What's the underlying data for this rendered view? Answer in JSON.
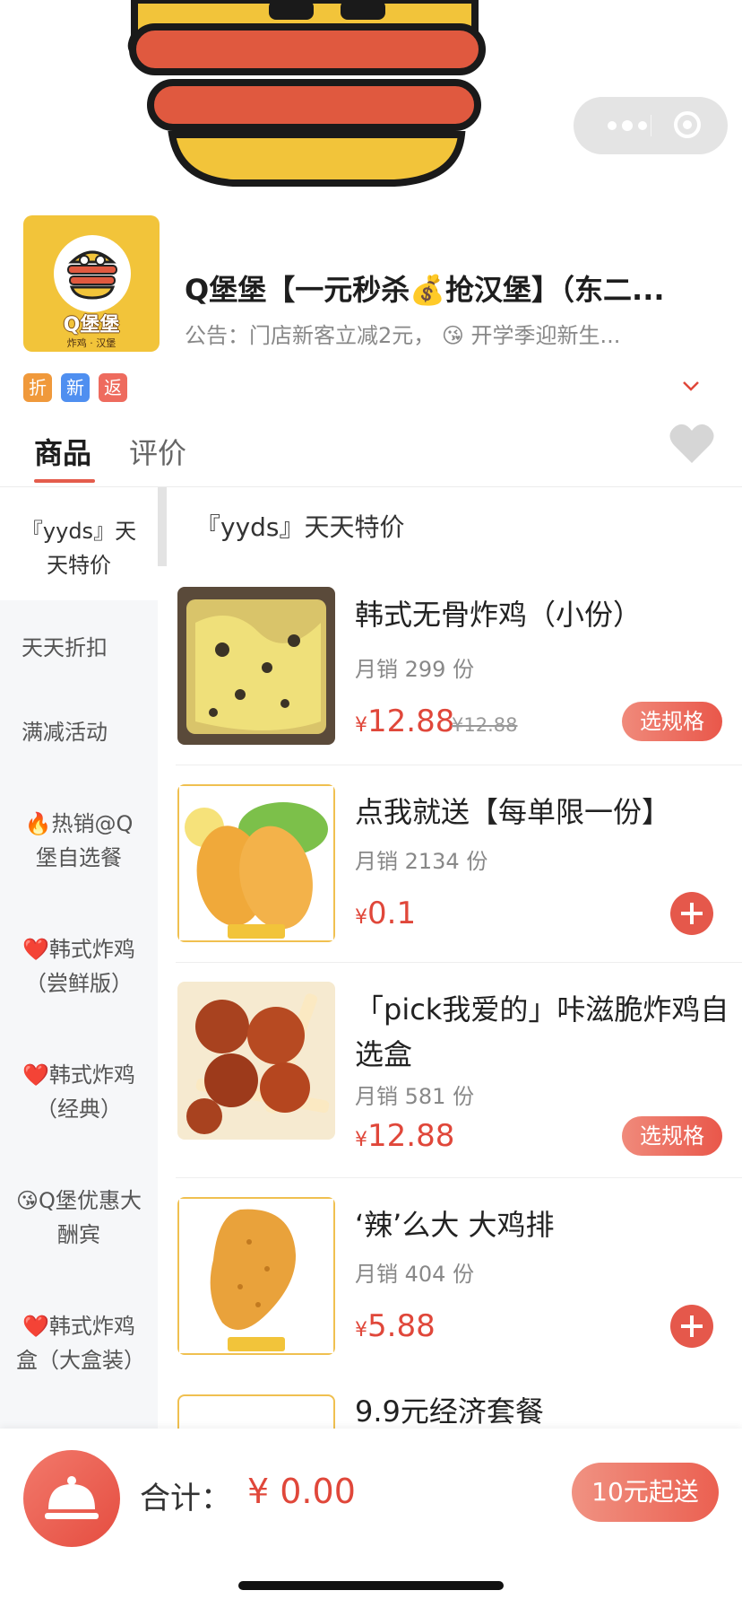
{
  "store": {
    "name": "Q堡堡【一元秒杀💰抢汉堡】（东二...",
    "notice": "公告：门店新客立减2元， 😘 开学季迎新生...",
    "logo_brand": "Q堡堡",
    "logo_sub": "炸鸡 · 汉堡",
    "badges": [
      "折",
      "新",
      "返"
    ]
  },
  "tabs": {
    "goods": "商品",
    "reviews": "评价"
  },
  "sidebar": {
    "items": [
      "『yyds』天天特价",
      "天天折扣",
      "满减活动",
      "🔥热销@Q堡自选餐",
      "❤️韩式炸鸡（尝鲜版）",
      "❤️韩式炸鸡（经典）",
      "😘Q堡优惠大酬宾",
      "❤️韩式炸鸡盒（大盒装）"
    ]
  },
  "category_title": "『yyds』天天特价",
  "products": [
    {
      "name": "韩式无骨炸鸡（小份）",
      "sales": "月销 299 份",
      "price_symbol": "¥",
      "price": "12.88",
      "original_price": "¥12.88",
      "action": "选规格"
    },
    {
      "name": "点我就送【每单限一份】",
      "sales": "月销 2134 份",
      "price_symbol": "¥",
      "price": "0.1",
      "action": "+"
    },
    {
      "name": "「pick我爱的」咔滋脆炸鸡自选盒",
      "sales": "月销 581 份",
      "price_symbol": "¥",
      "price": "12.88",
      "action": "选规格"
    },
    {
      "name": "‘辣’么大 大鸡排",
      "sales": "月销 404 份",
      "price_symbol": "¥",
      "price": "5.88",
      "action": "+"
    },
    {
      "name": "9.9元经济套餐"
    }
  ],
  "thumb_label": "Q堡堡",
  "cart": {
    "total_label": "合计：",
    "total_value": "¥ 0.00",
    "min_order": "10元起送"
  },
  "colors": {
    "accent": "#e0473a",
    "brand_yellow": "#f2c43a"
  }
}
